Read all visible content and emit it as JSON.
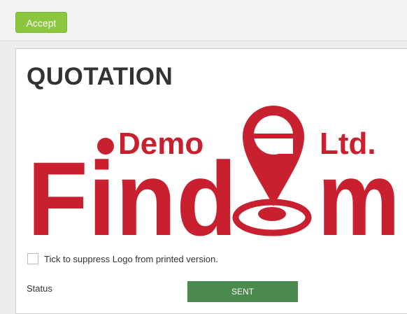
{
  "toolbar": {
    "accept_label": "Accept"
  },
  "document": {
    "title": "QUOTATION",
    "logo": {
      "brand_left": "Find",
      "brand_right": "m",
      "demo": "Demo",
      "suffix": "Ltd.",
      "color": "#c8202f"
    },
    "suppress_logo_label": "Tick to suppress Logo from printed version.",
    "suppress_logo_checked": false,
    "status_label": "Status",
    "status_value": "SENT"
  },
  "colors": {
    "accept_button": "#8cc63f",
    "status_badge": "#4a8a4c"
  }
}
